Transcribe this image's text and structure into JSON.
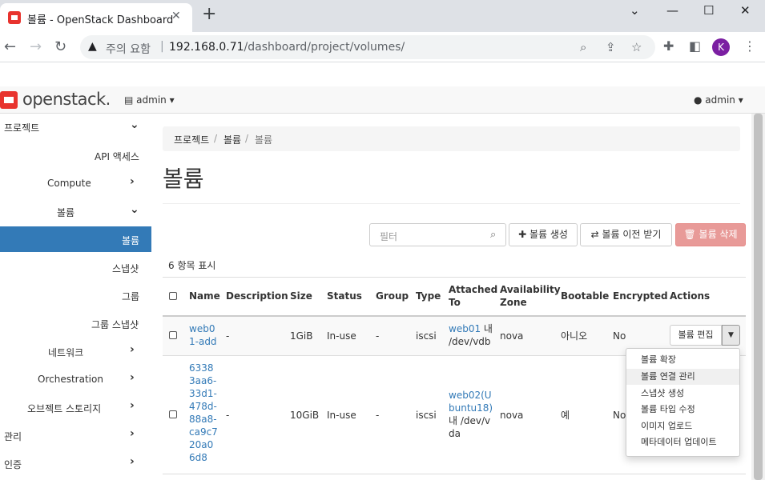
{
  "browser": {
    "tab_title": "볼륨 - OpenStack Dashboard",
    "warning": "주의 요함",
    "url_host": "192.168.0.71",
    "url_path": "/dashboard/project/volumes/",
    "profile_initial": "K"
  },
  "topbar": {
    "logo": "openstack.",
    "project": "admin ▾",
    "user": "admin ▾"
  },
  "sidebar": {
    "items": [
      {
        "label": "프로젝트"
      },
      {
        "label": "API 액세스"
      },
      {
        "label": "Compute"
      },
      {
        "label": "볼륨"
      },
      {
        "label": "볼륨"
      },
      {
        "label": "스냅샷"
      },
      {
        "label": "그룹"
      },
      {
        "label": "그룹 스냅샷"
      },
      {
        "label": "네트워크"
      },
      {
        "label": "Orchestration"
      },
      {
        "label": "오브젝트 스토리지"
      },
      {
        "label": "관리"
      },
      {
        "label": "인증"
      }
    ]
  },
  "breadcrumb": {
    "b1": "프로젝트",
    "b2": "볼륨",
    "b3": "볼륨",
    "sep": "/"
  },
  "page_title": "볼륨",
  "toolbar": {
    "filter_placeholder": "필터",
    "create": "볼륨 생성",
    "transfer": "볼륨 이전 받기",
    "delete": "볼륨 삭제"
  },
  "count_text": "6 항목 표시",
  "table": {
    "headers": {
      "name": "Name",
      "description": "Description",
      "size": "Size",
      "status": "Status",
      "group": "Group",
      "type": "Type",
      "attached1": "Attached",
      "attached2": "To",
      "az1": "Availability",
      "az2": "Zone",
      "bootable": "Bootable",
      "encrypted": "Encrypted",
      "actions": "Actions"
    },
    "rows": [
      {
        "name": [
          "web0",
          "1-add"
        ],
        "description": "-",
        "size": "1GiB",
        "status": "In-use",
        "group": "-",
        "type": "iscsi",
        "attached_link": "web01",
        "attached_rest1": " 내",
        "attached_rest2": "/dev/vdb",
        "az": "nova",
        "bootable": "아니오",
        "encrypted": "No"
      },
      {
        "name": [
          "6338",
          "3aa6-",
          "33d1-",
          "478d-",
          "88a8-",
          "ca9c7",
          "20a0",
          "6d8"
        ],
        "description": "-",
        "size": "10GiB",
        "status": "In-use",
        "group": "-",
        "type": "iscsi",
        "attached_link1": "web02(U",
        "attached_link2": "buntu18)",
        "attached_rest1": "내 /dev/v",
        "attached_rest2": "da",
        "az": "nova",
        "bootable": "예",
        "encrypted": "No"
      }
    ]
  },
  "actions": {
    "edit": "볼륨 편집",
    "menu": [
      "볼륨 확장",
      "볼륨 연결 관리",
      "스냅샷 생성",
      "볼륨 타입 수정",
      "이미지 업로드",
      "메타데이터 업데이트"
    ]
  }
}
